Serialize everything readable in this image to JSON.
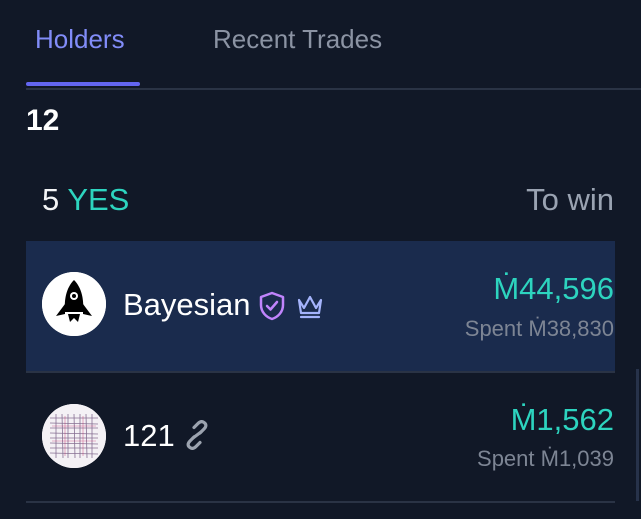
{
  "tabs": [
    {
      "label": "Holders",
      "active": true
    },
    {
      "label": "Recent Trades",
      "active": false
    }
  ],
  "holder_count": "12",
  "outcome": {
    "count": "5",
    "label": "YES"
  },
  "column_header": "To win",
  "holders": [
    {
      "name": "Bayesian",
      "to_win": "Ṁ44,596",
      "spent": "Spent Ṁ38,830",
      "badges": [
        "verified-shield-icon",
        "crown-icon"
      ],
      "avatar": "rocket-avatar"
    },
    {
      "name": "121",
      "to_win": "Ṁ1,562",
      "spent": "Spent Ṁ1,039",
      "badges": [
        "link-icon"
      ],
      "avatar": "pattern-avatar"
    }
  ],
  "colors": {
    "background": "#111827",
    "accent": "#818cf8",
    "yes": "#2dd4bf",
    "highlight_row": "#1a2b4d"
  }
}
